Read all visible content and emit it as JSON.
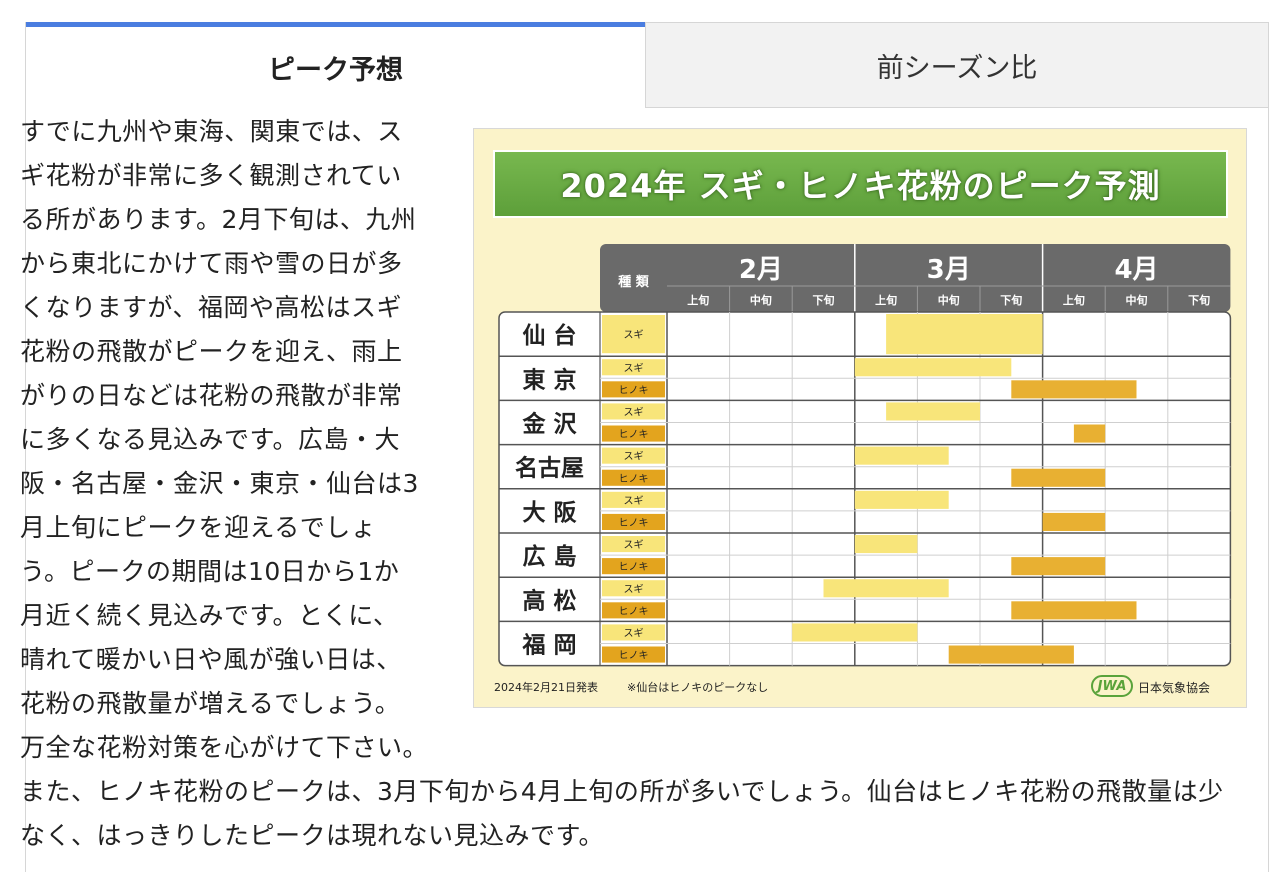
{
  "tabs": [
    {
      "label": "ピーク予想",
      "active": true
    },
    {
      "label": "前シーズン比",
      "active": false
    }
  ],
  "article": {
    "paragraph1": "すでに九州や東海、関東では、スギ花粉が非常に多く観測されている所があります。2月下旬は、九州から東北にかけて雨や雪の日が多くなりますが、福岡や高松はスギ花粉の飛散がピークを迎え、雨上がりの日などは花粉の飛散が非常に多くなる見込みです。広島・大阪・名古屋・金沢・東京・仙台は3月上旬にピークを迎えるでしょう。ピークの期間は10日から1か月近く続く見込みです。とくに、晴れて暖かい日や風が強い日は、花粉の飛散量が増えるでしょう。万全な花粉対策を心がけて下さい。",
    "paragraph2": "また、ヒノキ花粉のピークは、3月下旬から4月上旬の所が多いでしょう。仙台はヒノキ花粉の飛散量は少なく、はっきりしたピークは現れない見込みです。"
  },
  "figure": {
    "title": "2024年 スギ・ヒノキ花粉のピーク予測",
    "type_header": "種 類",
    "months": [
      "2月",
      "3月",
      "4月"
    ],
    "periods": [
      "上旬",
      "中旬",
      "下旬"
    ],
    "footer_date": "2024年2月21日発表",
    "footer_note": "※仙台はヒノキのピークなし",
    "logo_mark": "JWA",
    "logo_text": "日本気象協会",
    "colors": {
      "sugi": "#f8e57a",
      "hinoki": "#e8b032",
      "header": "#6a6a6a",
      "sugi_label": "#f8e57a",
      "hinoki_label": "#e3a41e"
    },
    "cities": [
      {
        "name": "仙 台",
        "rows": [
          {
            "type": "スギ",
            "kind": "sugi",
            "start": 3.5,
            "end": 6.0
          }
        ]
      },
      {
        "name": "東 京",
        "rows": [
          {
            "type": "スギ",
            "kind": "sugi",
            "start": 3.0,
            "end": 5.5
          },
          {
            "type": "ヒノキ",
            "kind": "hinoki",
            "start": 5.5,
            "end": 7.5
          }
        ]
      },
      {
        "name": "金 沢",
        "rows": [
          {
            "type": "スギ",
            "kind": "sugi",
            "start": 3.5,
            "end": 5.0
          },
          {
            "type": "ヒノキ",
            "kind": "hinoki",
            "start": 6.5,
            "end": 7.0
          }
        ]
      },
      {
        "name": "名古屋",
        "rows": [
          {
            "type": "スギ",
            "kind": "sugi",
            "start": 3.0,
            "end": 4.5
          },
          {
            "type": "ヒノキ",
            "kind": "hinoki",
            "start": 5.5,
            "end": 7.0
          }
        ]
      },
      {
        "name": "大 阪",
        "rows": [
          {
            "type": "スギ",
            "kind": "sugi",
            "start": 3.0,
            "end": 4.5
          },
          {
            "type": "ヒノキ",
            "kind": "hinoki",
            "start": 6.0,
            "end": 7.0
          }
        ]
      },
      {
        "name": "広 島",
        "rows": [
          {
            "type": "スギ",
            "kind": "sugi",
            "start": 3.0,
            "end": 4.0
          },
          {
            "type": "ヒノキ",
            "kind": "hinoki",
            "start": 5.5,
            "end": 7.0
          }
        ]
      },
      {
        "name": "高 松",
        "rows": [
          {
            "type": "スギ",
            "kind": "sugi",
            "start": 2.5,
            "end": 4.5
          },
          {
            "type": "ヒノキ",
            "kind": "hinoki",
            "start": 5.5,
            "end": 7.5
          }
        ]
      },
      {
        "name": "福 岡",
        "rows": [
          {
            "type": "スギ",
            "kind": "sugi",
            "start": 2.0,
            "end": 4.0
          },
          {
            "type": "ヒノキ",
            "kind": "hinoki",
            "start": 4.5,
            "end": 6.5
          }
        ]
      }
    ]
  }
}
